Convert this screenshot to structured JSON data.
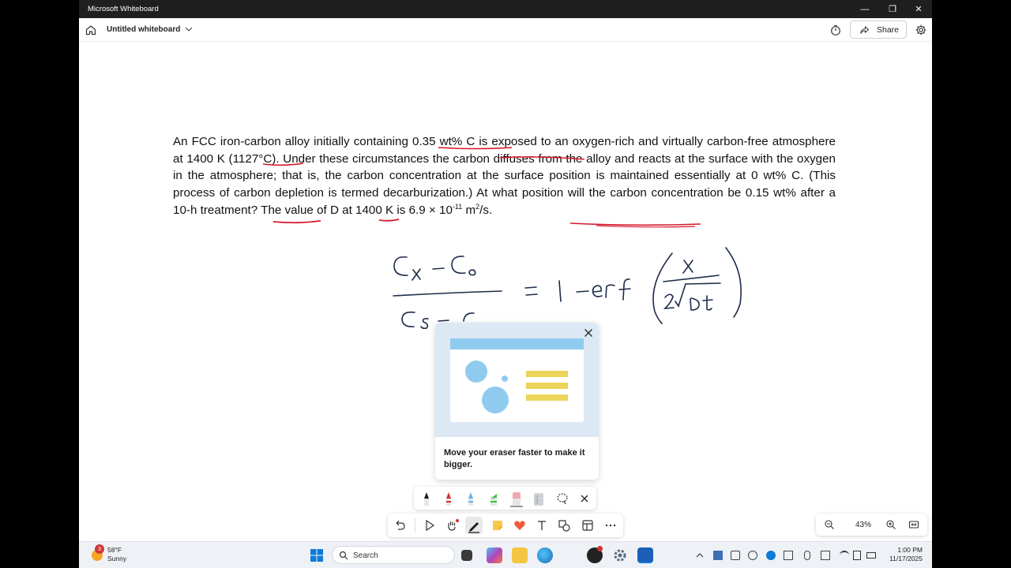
{
  "window": {
    "title": "Microsoft Whiteboard",
    "minimize": "—",
    "maximize": "❐",
    "close": "✕"
  },
  "header": {
    "board_title": "Untitled whiteboard",
    "share_label": "Share"
  },
  "problem": {
    "part1": "An FCC iron-carbon alloy initially containing 0.35 wt% C is exposed to an oxygen-rich and virtually carbon-free atmosphere at 1400 K (1127°C).  Under these circumstances the carbon diffuses from the alloy and reacts at the surface with the oxygen in the atmosphere; that is, the carbon concentration at the surface position is maintained essentially at 0 wt% C. (This process of carbon depletion is termed decarburization.) At what position will the carbon concentration be 0.15 wt% after a 10-h treatment?  The value of D at 1400 K is 6.9 × 10",
    "exp": "-11",
    "part2": " m",
    "exp2": "2",
    "part3": "/s."
  },
  "handwriting": {
    "numerator": "Cx - Co",
    "denominator": "Cs - Co",
    "equals": "=",
    "rhs": "1 -erf",
    "frac_num": "x",
    "frac_den": "2√Dt"
  },
  "tooltip": {
    "message": "Move your eraser faster to make it bigger."
  },
  "pens": [
    {
      "name": "black-pen",
      "color": "#1a1a1a"
    },
    {
      "name": "red-pen",
      "color": "#d32f2f"
    },
    {
      "name": "blue-pen",
      "color": "#64b5f6"
    },
    {
      "name": "green-pen",
      "color": "#3cc43c"
    },
    {
      "name": "eraser",
      "color": "#f1a7b0"
    },
    {
      "name": "ruler",
      "color": "#cfd3d7"
    }
  ],
  "zoom": {
    "value": "43%"
  },
  "taskbar": {
    "weather_temp": "58°F",
    "weather_desc": "Sunny",
    "weather_badge": "3",
    "search_placeholder": "Search",
    "time": "1:00 PM",
    "date": "11/17/2025"
  },
  "colors": {
    "ink": "#1d2b4a",
    "red_ink": "#d6182d",
    "accent": "#5b9bd5"
  }
}
